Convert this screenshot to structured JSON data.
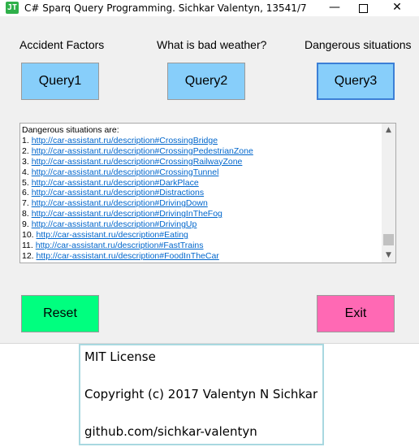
{
  "window": {
    "title": "C# Sparq Query Programming. Sichkar Valentyn, 13541/7",
    "icon_glyph": "JT",
    "minimize_glyph": "—",
    "close_glyph": "✕"
  },
  "labels": {
    "accident": "Accident Factors",
    "weather": "What is bad weather?",
    "dangerous": "Dangerous situations"
  },
  "buttons": {
    "query1": "Query1",
    "query2": "Query2",
    "query3": "Query3",
    "reset": "Reset",
    "exit": "Exit"
  },
  "colors": {
    "query_button": "#87cefa",
    "reset_button": "#00ff7f",
    "exit_button": "#ff69b4",
    "link": "#0066cc"
  },
  "results": {
    "heading": "Dangerous situations are:",
    "items": [
      {
        "num": "1.",
        "url": "http://car-assistant.ru/description#CrossingBridge"
      },
      {
        "num": "2.",
        "url": "http://car-assistant.ru/description#CrossingPedestrianZone"
      },
      {
        "num": "3.",
        "url": "http://car-assistant.ru/description#CrossingRailwayZone"
      },
      {
        "num": "4.",
        "url": "http://car-assistant.ru/description#CrossingTunnel"
      },
      {
        "num": "5.",
        "url": "http://car-assistant.ru/description#DarkPlace"
      },
      {
        "num": "6.",
        "url": "http://car-assistant.ru/description#Distractions"
      },
      {
        "num": "7.",
        "url": "http://car-assistant.ru/description#DrivingDown"
      },
      {
        "num": "8.",
        "url": "http://car-assistant.ru/description#DrivingInTheFog"
      },
      {
        "num": "9.",
        "url": "http://car-assistant.ru/description#DrivingUp"
      },
      {
        "num": "10.",
        "url": "http://car-assistant.ru/description#Eating"
      },
      {
        "num": "11.",
        "url": "http://car-assistant.ru/description#FastTrains"
      },
      {
        "num": "12.",
        "url": "http://car-assistant.ru/description#FoodInTheCar"
      }
    ]
  },
  "license": {
    "line1": "MIT License",
    "line2": "Copyright (c) 2017 Valentyn N Sichkar",
    "line3": "github.com/sichkar-valentyn"
  }
}
